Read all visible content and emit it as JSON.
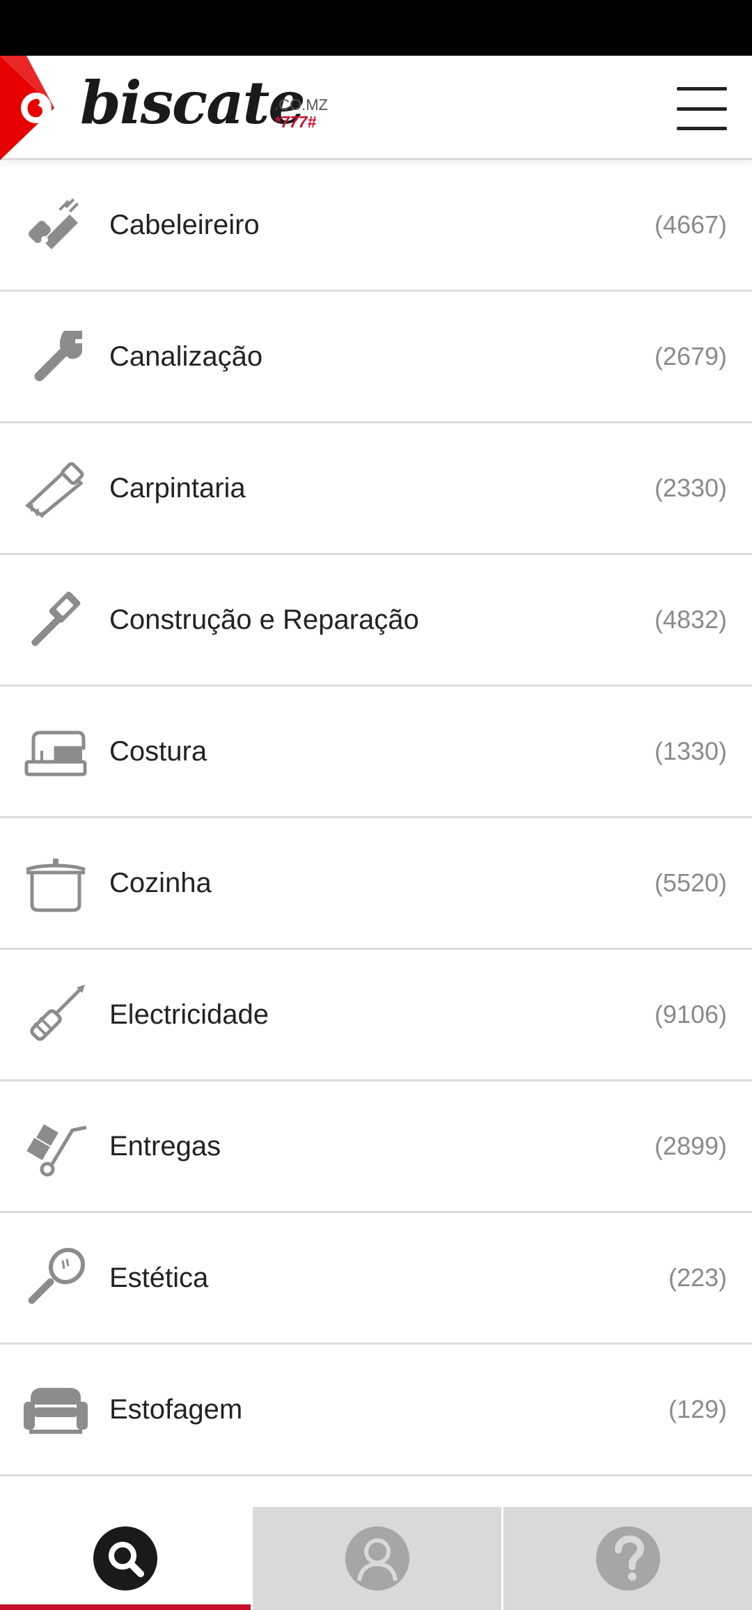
{
  "header": {
    "logo_word": "biscate",
    "logo_domain": ".CO.MZ",
    "logo_code": "*777#",
    "menu_icon": "hamburger-menu-icon"
  },
  "colors": {
    "brand_red": "#e60000",
    "accent_red": "#c8102e",
    "icon_gray": "#8c8c8c",
    "count_gray": "#8a8a8a"
  },
  "categories": [
    {
      "label": "Cabeleireiro",
      "count": "(4667)",
      "icon": "hair-clipper-icon"
    },
    {
      "label": "Canalização",
      "count": "(2679)",
      "icon": "wrench-icon"
    },
    {
      "label": "Carpintaria",
      "count": "(2330)",
      "icon": "saw-icon"
    },
    {
      "label": "Construção e Reparação",
      "count": "(4832)",
      "icon": "hammer-icon"
    },
    {
      "label": "Costura",
      "count": "(1330)",
      "icon": "sewing-machine-icon"
    },
    {
      "label": "Cozinha",
      "count": "(5520)",
      "icon": "cooking-pot-icon"
    },
    {
      "label": "Electricidade",
      "count": "(9106)",
      "icon": "screwdriver-icon"
    },
    {
      "label": "Entregas",
      "count": "(2899)",
      "icon": "hand-truck-icon"
    },
    {
      "label": "Estética",
      "count": "(223)",
      "icon": "mirror-icon"
    },
    {
      "label": "Estofagem",
      "count": "(129)",
      "icon": "sofa-icon"
    }
  ],
  "bottom_nav": [
    {
      "icon": "search-icon",
      "active": true
    },
    {
      "icon": "profile-icon",
      "active": false
    },
    {
      "icon": "help-icon",
      "active": false
    }
  ]
}
